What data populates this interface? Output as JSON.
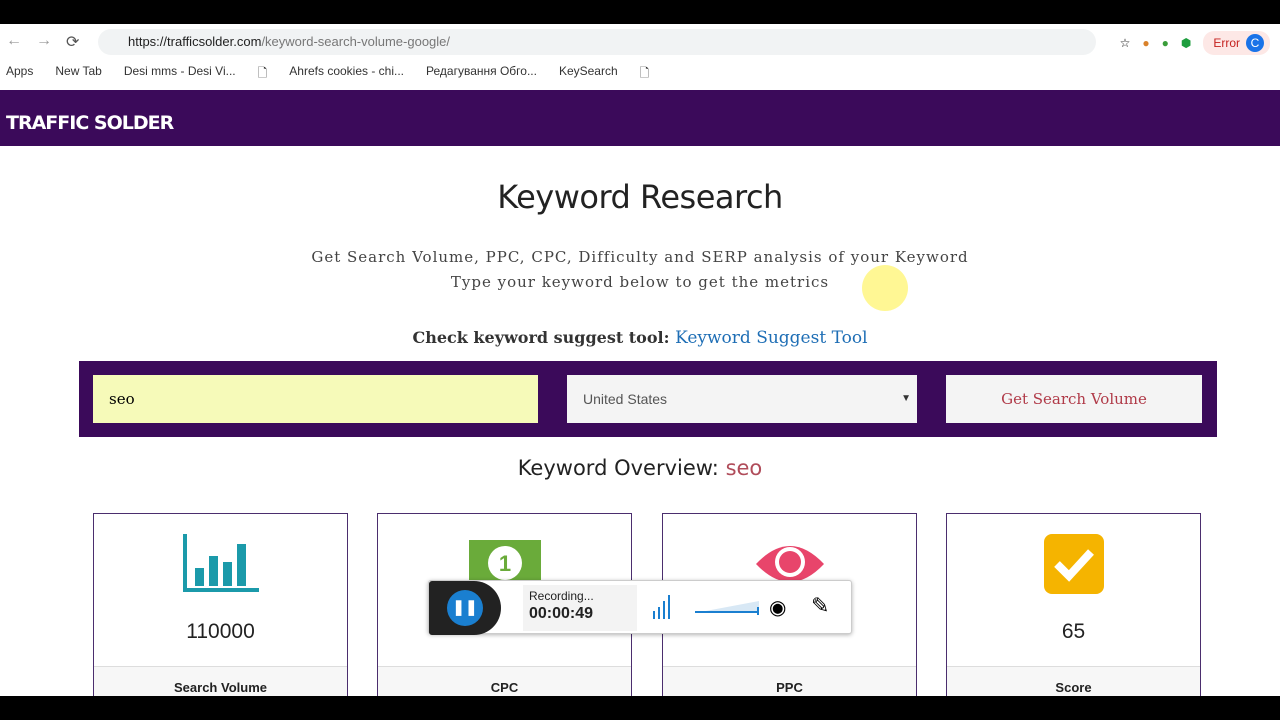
{
  "browser": {
    "url_domain": "https://trafficsolder.com",
    "url_path": "/keyword-search-volume-google/",
    "bookmarks": [
      "Apps",
      "New Tab",
      "Desi mms - Desi Vi...",
      "",
      "Ahrefs cookies - chi...",
      "Редагування Обго...",
      "KeySearch",
      ""
    ],
    "error_label": "Error",
    "profile_initial": "C"
  },
  "site": {
    "brand": "TRAFFIC SOLDER"
  },
  "main": {
    "title": "Keyword Research",
    "subtitle1": "Get Search Volume, PPC, CPC, Difficulty and SERP analysis of your Keyword",
    "subtitle2": "Type your keyword below to get the metrics",
    "suggest_label": "Check keyword suggest tool:",
    "suggest_link": "Keyword Suggest Tool",
    "keyword_value": "seo",
    "country": "United States",
    "submit": "Get Search Volume",
    "overview_label": "Keyword Overview:",
    "overview_keyword": "seo",
    "cards": [
      {
        "value": "110000",
        "label": "Search Volume",
        "icon": "bar-chart-icon",
        "color": "#1b9aaa"
      },
      {
        "value": "",
        "label": "CPC",
        "icon": "money-bill-icon",
        "color": "#6aab3a"
      },
      {
        "value": "",
        "label": "PPC",
        "icon": "eye-icon",
        "color": "#e8456b"
      },
      {
        "value": "65",
        "label": "Score",
        "icon": "checkbox-icon",
        "color": "#f5b400"
      }
    ]
  },
  "recorder": {
    "status": "Recording...",
    "time": "00:00:49"
  }
}
